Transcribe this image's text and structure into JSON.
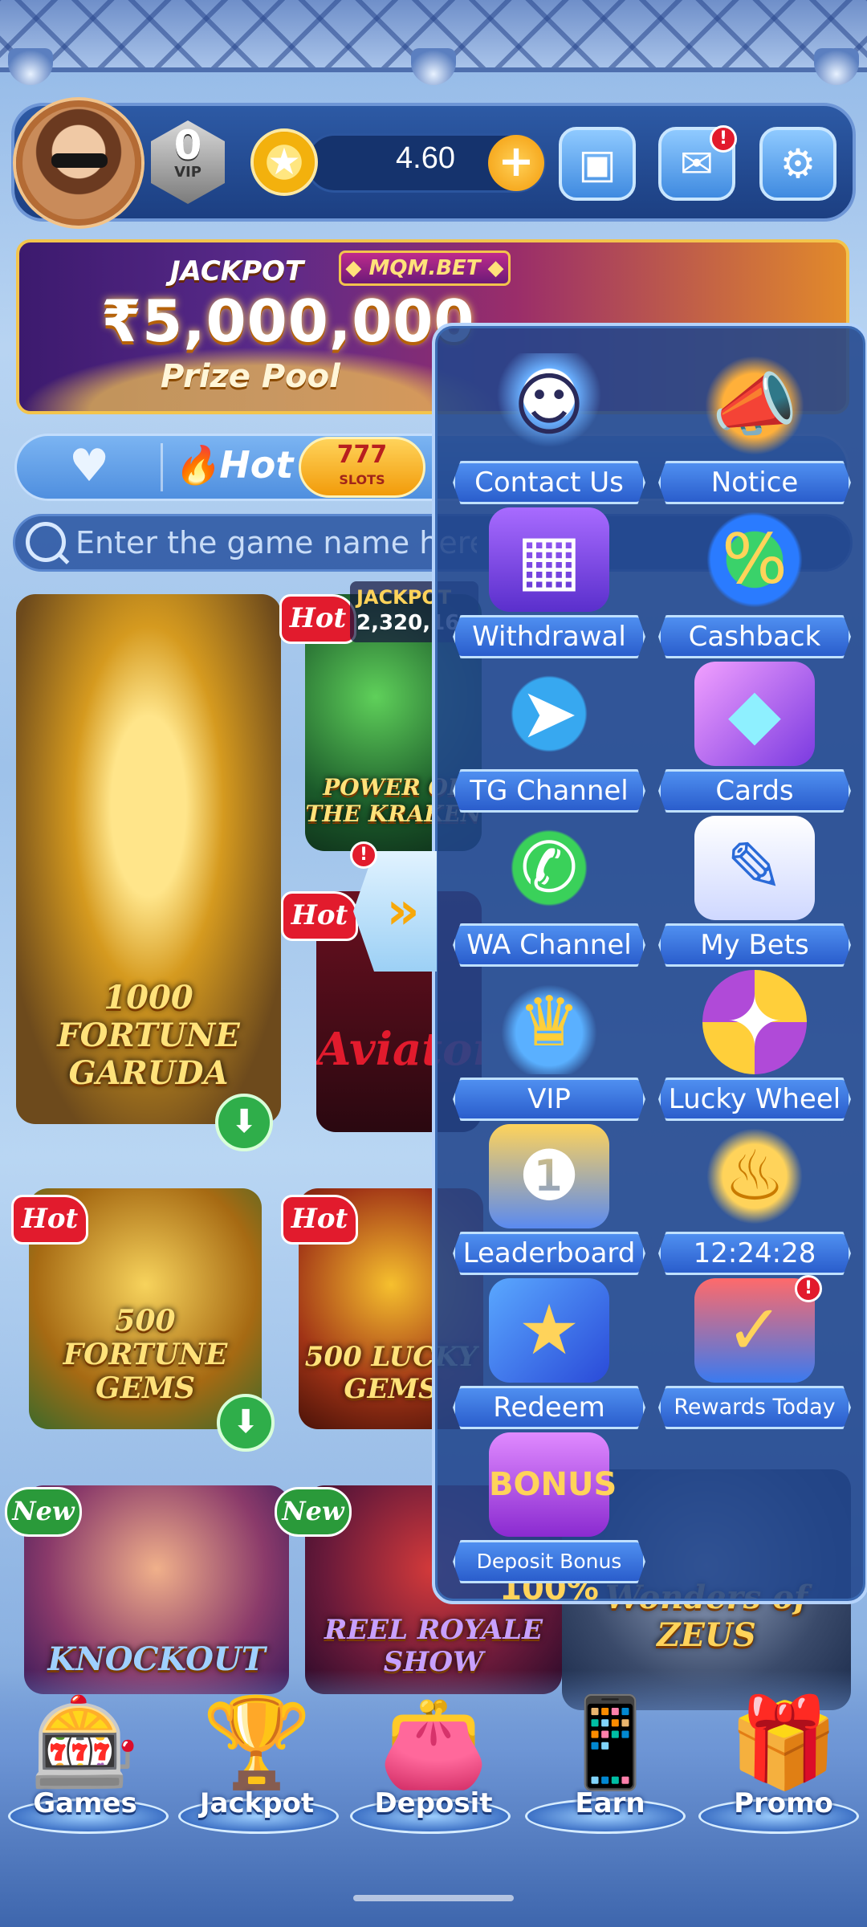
{
  "header": {
    "vip_level": "0",
    "vip_label": "VIP",
    "balance": "4.60",
    "plus_label": "+",
    "icons": [
      "avatar",
      "vip-badge",
      "coin-icon",
      "plus-icon",
      "wallet-icon",
      "mail-icon",
      "gear-icon"
    ],
    "mail_alert": "!"
  },
  "banner": {
    "jackpot_label": "JACKPOT",
    "brand": "◆ MQM.BET ◆",
    "amount": "₹5,000,000",
    "subtitle": "Prize Pool"
  },
  "tabs": {
    "favorites_icon": "♥",
    "hot_label": "Hot",
    "slots_top": "777",
    "slots_bottom": "SLOTS"
  },
  "search": {
    "placeholder": "Enter the game name here"
  },
  "games": {
    "items": [
      {
        "title": "1000 FORTUNE GARUDA",
        "badge": ""
      },
      {
        "title": "POWER OF THE KRAKEN",
        "badge": "Hot"
      },
      {
        "title": "Aviator",
        "badge": "Hot"
      },
      {
        "title": "500 FORTUNE GEMS",
        "badge": "Hot"
      },
      {
        "title": "500 LUCKY GEMS",
        "badge": "Hot"
      },
      {
        "title": "KNOCKOUT",
        "badge": "New"
      },
      {
        "title": "REEL ROYALE SHOW",
        "badge": "New"
      },
      {
        "title": "Wonders of ZEUS",
        "badge": ""
      }
    ],
    "hot_badge": "Hot",
    "new_badge": "New",
    "mini_jackpot_label": "JACKPOT",
    "mini_jackpot_value": "2,320,16"
  },
  "drawer": {
    "toggle_icon": "»",
    "toggle_alert": "!",
    "items": [
      {
        "label": "Contact Us",
        "icon": "support-agent-icon"
      },
      {
        "label": "Notice",
        "icon": "megaphone-icon"
      },
      {
        "label": "Withdrawal",
        "icon": "atm-icon"
      },
      {
        "label": "Cashback",
        "icon": "gift-cashback-icon"
      },
      {
        "label": "TG Channel",
        "icon": "telegram-icon"
      },
      {
        "label": "Cards",
        "icon": "diamond-card-icon"
      },
      {
        "label": "WA Channel",
        "icon": "whatsapp-icon"
      },
      {
        "label": "My Bets",
        "icon": "notepad-icon"
      },
      {
        "label": "VIP",
        "icon": "crown-icon"
      },
      {
        "label": "Lucky Wheel",
        "icon": "wheel-icon"
      },
      {
        "label": "Leaderboard",
        "icon": "podium-icon"
      },
      {
        "label": "12:24:28",
        "icon": "magic-lamp-icon"
      },
      {
        "label": "Redeem",
        "icon": "ticket-icon"
      },
      {
        "label": "Rewards Today",
        "icon": "calendar-gift-icon"
      },
      {
        "label": "Deposit Bonus",
        "icon": "bonus-gift-icon"
      }
    ],
    "rewards_alert": "!",
    "bonus_text": "BONUS 100%"
  },
  "bottom_nav": {
    "items": [
      {
        "label": "Games",
        "icon": "slot-machine-icon"
      },
      {
        "label": "Jackpot",
        "icon": "trophy-icon"
      },
      {
        "label": "Deposit",
        "icon": "wallet-icon"
      },
      {
        "label": "Earn",
        "icon": "phone-coins-icon"
      },
      {
        "label": "Promo",
        "icon": "gift-box-icon"
      }
    ]
  },
  "colors": {
    "header_bg": "#2d5aa5",
    "drawer_bg": "#21468c",
    "accent_gold": "#f3c44c",
    "alert_red": "#e21b2d"
  }
}
